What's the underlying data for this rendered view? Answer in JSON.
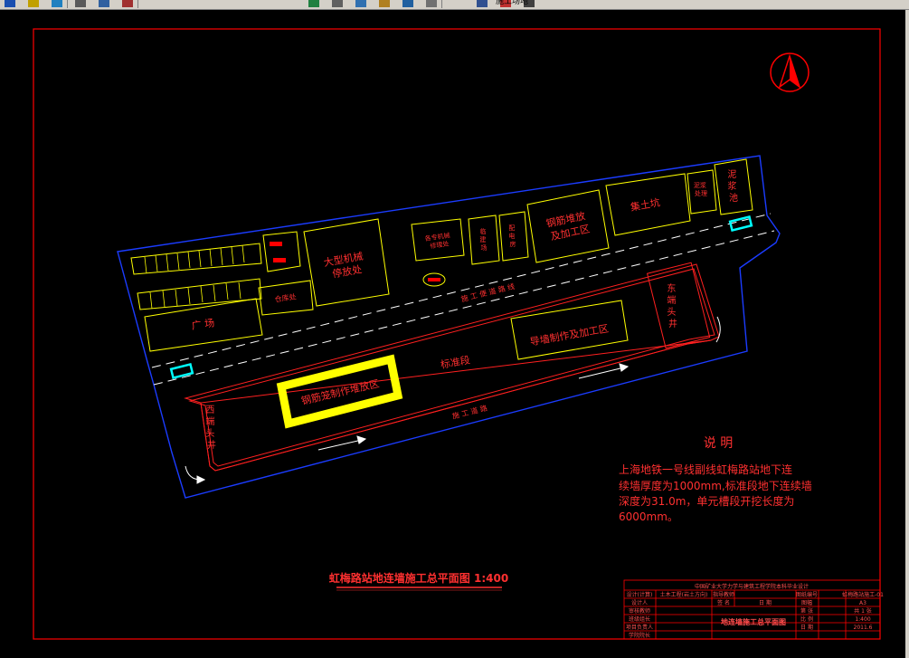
{
  "toolbar": {
    "buttons": [
      "save-icon",
      "undo-icon",
      "redo-icon",
      "pan-icon",
      "zoom-realtime-icon",
      "zoom-window-icon",
      "zoom-previous-icon",
      "properties-icon",
      "design-center-icon",
      "tool-palettes-icon",
      "layer-icon",
      "layer-previous-icon",
      "layer-state-icon",
      "color-icon",
      "linetype-icon"
    ],
    "layer_name": "施工场地"
  },
  "drawing": {
    "title": "虹梅路站地连墙施工总平面图 1:400",
    "north_arrow": "north-arrow",
    "labels": {
      "large_machinery": "大型机械\n停放处",
      "plaza": "广   场",
      "warehouse": "仓库处",
      "mech_repair": "各专机械\n修理处",
      "station1": "临\n建\n场",
      "station2": "配\n电\n房",
      "rebar_stack": "钢筋堆放\n及加工区",
      "spoil": "集土坑",
      "mud_tank": "泥浆\n处理",
      "mud_pit": "泥\n浆\n池",
      "guide_wall": "导墙制作及加工区",
      "cage_area": "钢筋笼制作堆放区",
      "standard_section": "标准段",
      "east_well": "东\n端\n头\n井",
      "west_well": "西\n端\n头\n井",
      "road": "施   工   道   路",
      "temp_road": "施   工   便   道   路   线"
    }
  },
  "notes": {
    "heading": "说    明",
    "body_lines": [
      "上海地铁一号线副线虹梅路站地下连",
      "续墙厚度为1000mm,标准段地下连续墙",
      "深度为31.0m，单元槽段开挖长度为",
      "6000mm。"
    ]
  },
  "title_block": {
    "header": "中国矿业大学力学与建筑工程学院本科毕业设计",
    "left_rows": [
      "设计(计算)",
      "设计人",
      "审核教师",
      "班级组长",
      "项目负责人",
      "学院院长"
    ],
    "mid_rows": [
      "土木工程(岩土方向)",
      "",
      "",
      ""
    ],
    "sign_cols": [
      "指导教师",
      "签 名",
      "日 期"
    ],
    "drawing_name": "地连墙施工总平面图",
    "right_rows": [
      [
        "图纸编号",
        "虹梅路站施工-01"
      ],
      [
        "图幅",
        "A3"
      ],
      [
        "第 张",
        "共 1 张"
      ],
      [
        "比 例",
        "1:400"
      ],
      [
        "日 期",
        "2011.6"
      ]
    ]
  },
  "colors": {
    "frame": "#ff0000",
    "site_boundary": "#0000ff",
    "buildings": "#ffff00",
    "text_red": "#ff3030",
    "cyan": "#00ffff",
    "white": "#ffffff"
  }
}
